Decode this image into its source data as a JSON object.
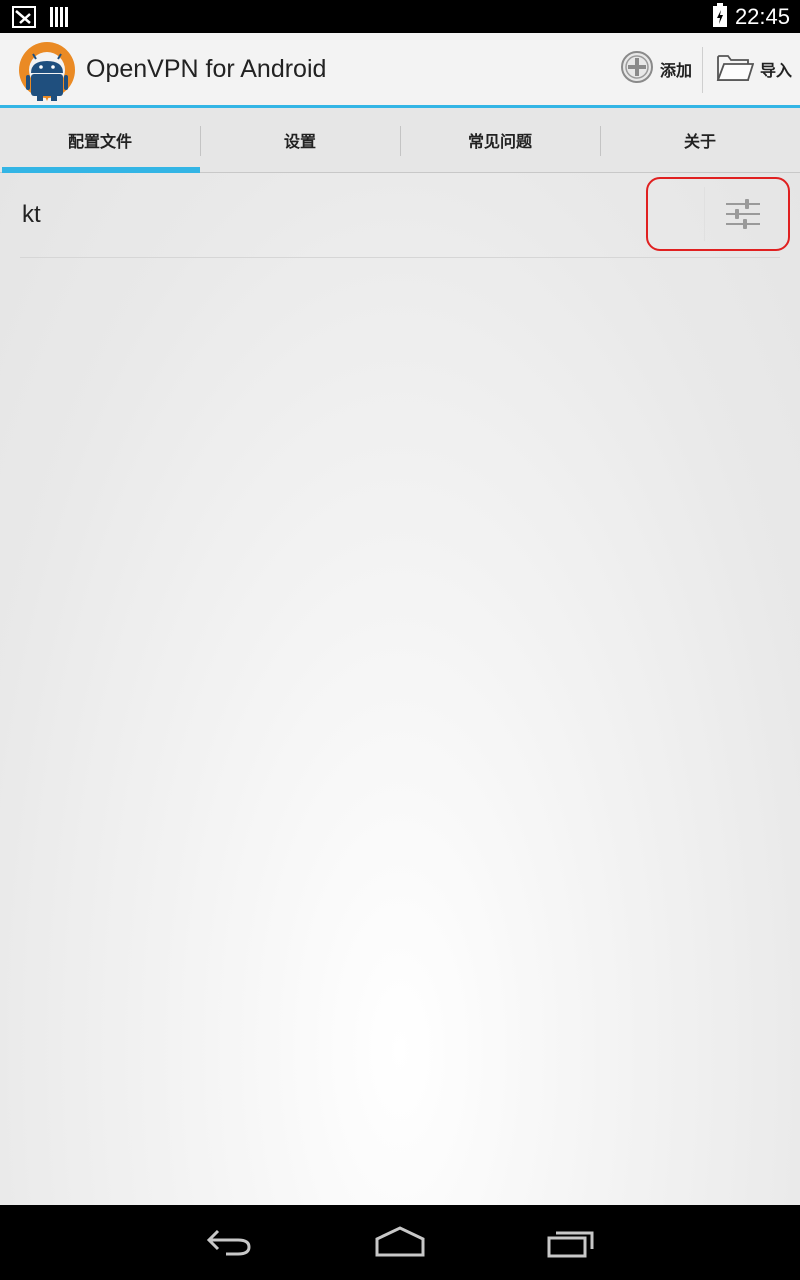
{
  "status_bar": {
    "time": "22:45",
    "icons": [
      "notification-icon",
      "barcode-icon",
      "battery-icon"
    ]
  },
  "action_bar": {
    "title": "OpenVPN for Android",
    "add_label": "添加",
    "import_label": "导入",
    "accent_color": "#33b5e5"
  },
  "tabs": [
    {
      "label": "配置文件",
      "active": true
    },
    {
      "label": "设置",
      "active": false
    },
    {
      "label": "常见问题",
      "active": false
    },
    {
      "label": "关于",
      "active": false
    }
  ],
  "profiles": [
    {
      "name": "kt"
    }
  ],
  "nav_bar": {
    "buttons": [
      "back-icon",
      "home-icon",
      "recent-apps-icon"
    ]
  }
}
